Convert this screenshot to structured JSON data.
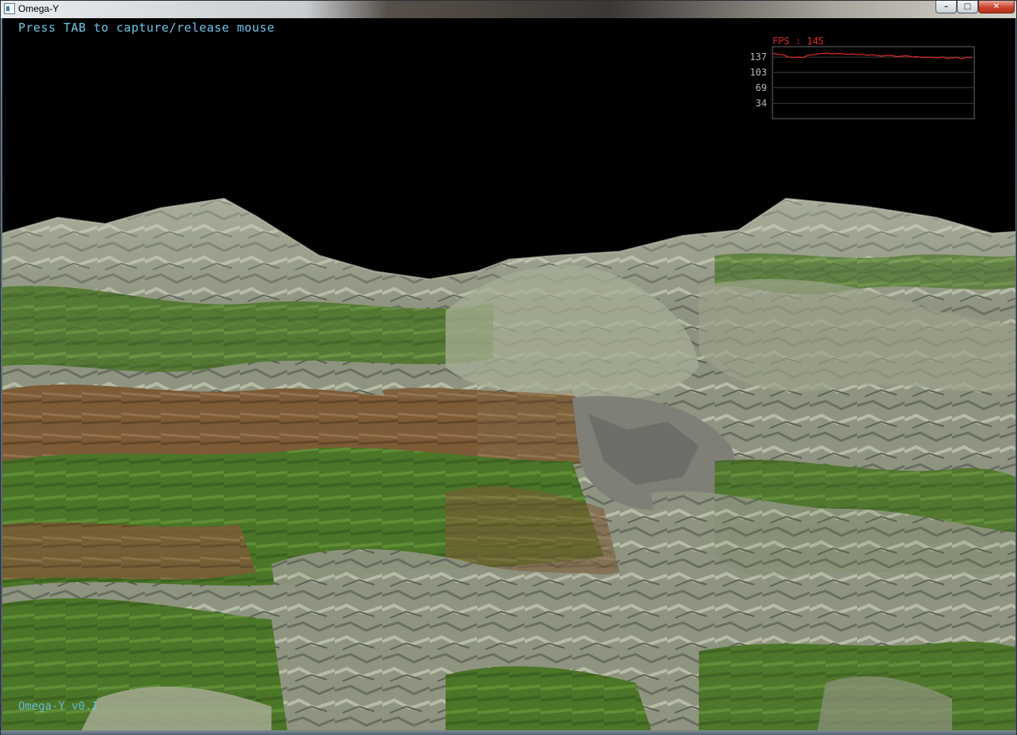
{
  "window": {
    "title": "Omega-Y",
    "icon": "application-icon",
    "controls": {
      "minimize": "–",
      "maximize": "□",
      "close": "✕"
    }
  },
  "hud": {
    "hint": "Press TAB to capture/release mouse",
    "version": "Omega-Y v0.1"
  },
  "fps": {
    "label": "FPS : 145",
    "current": 145,
    "ticks": [
      "137",
      "103",
      "69",
      "34"
    ],
    "line_color": "#e42a2a",
    "history": [
      145,
      143,
      142,
      137,
      136,
      137,
      136,
      141,
      142,
      144,
      145,
      146,
      144,
      145,
      144,
      143,
      144,
      142,
      143,
      141,
      142,
      140,
      139,
      141,
      140,
      138,
      139,
      140,
      137,
      138,
      136,
      137,
      136,
      135,
      137,
      134,
      135,
      136,
      133,
      137,
      135
    ]
  },
  "colors": {
    "hud_text": "#6cc6ea",
    "sky": "#000000",
    "grass": "#4e7a2a",
    "rock": "#9aa08a",
    "soil": "#7a5a35"
  }
}
